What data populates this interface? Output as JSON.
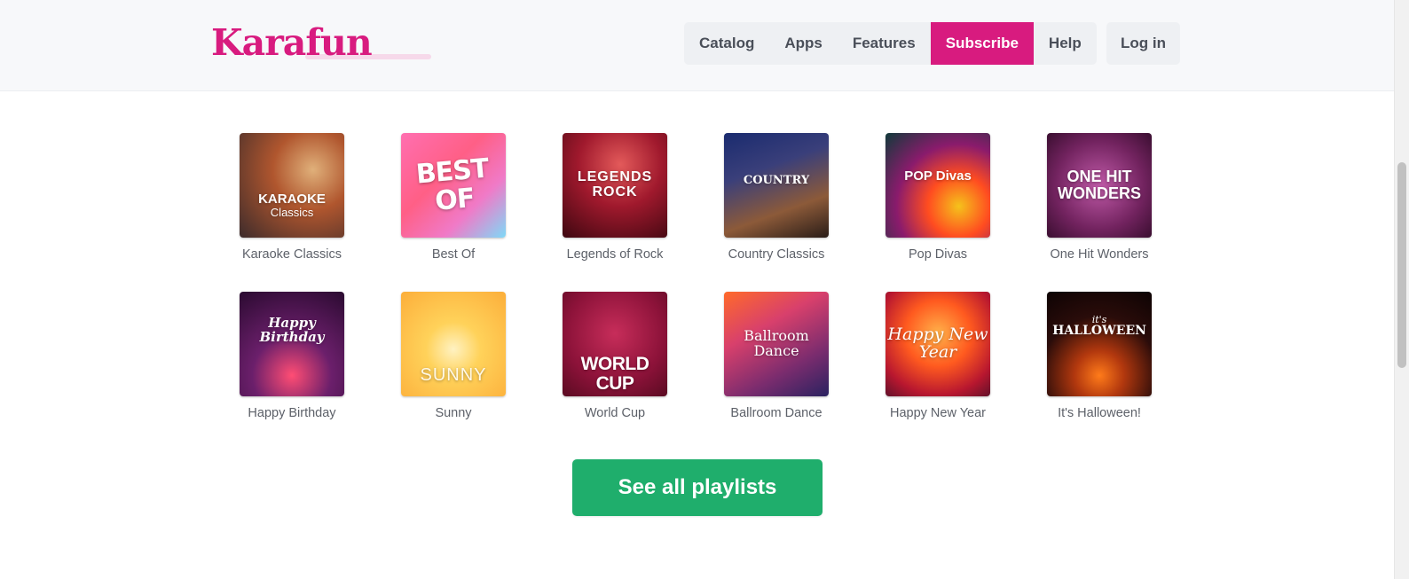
{
  "header": {
    "logo": "Karafun",
    "nav": [
      {
        "label": "Catalog"
      },
      {
        "label": "Apps"
      },
      {
        "label": "Features"
      },
      {
        "label": "Subscribe"
      },
      {
        "label": "Help"
      }
    ],
    "login": "Log in"
  },
  "playlists": [
    {
      "label": "Karaoke Classics",
      "cover_title": "KARAOKE",
      "cover_sub": "Classics"
    },
    {
      "label": "Best Of",
      "cover_title": "BEST OF"
    },
    {
      "label": "Legends of Rock",
      "cover_title": "LEGENDS ROCK"
    },
    {
      "label": "Country Classics",
      "cover_title": "COUNTRY"
    },
    {
      "label": "Pop Divas",
      "cover_title": "POP Divas"
    },
    {
      "label": "One Hit Wonders",
      "cover_title": "ONE HIT WONDERS"
    },
    {
      "label": "Happy Birthday",
      "cover_title": "Happy Birthday"
    },
    {
      "label": "Sunny",
      "cover_title": "SUNNY"
    },
    {
      "label": "World Cup",
      "cover_title": "WORLD CUP"
    },
    {
      "label": "Ballroom Dance",
      "cover_title": "Ballroom Dance"
    },
    {
      "label": "Happy New Year",
      "cover_title": "Happy New Year"
    },
    {
      "label": "It's Halloween!",
      "cover_title": "HALLOWEEN",
      "cover_sub": "it's"
    }
  ],
  "cta": {
    "label": "See all playlists"
  },
  "colors": {
    "brand": "#d81b7f",
    "cta": "#1fae6c",
    "nav_bg": "#eef0f3"
  }
}
